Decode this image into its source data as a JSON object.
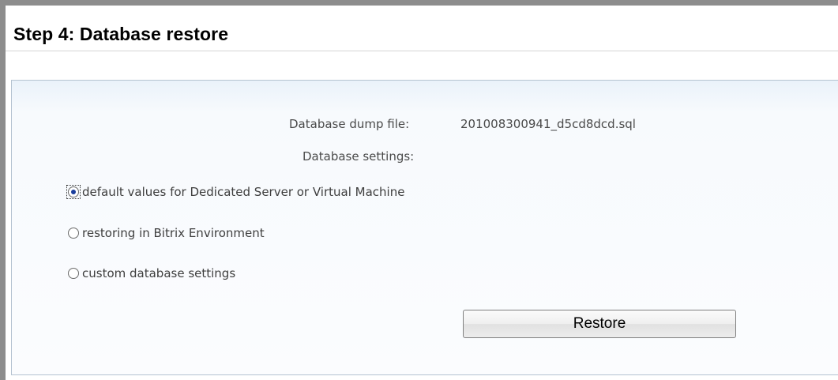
{
  "header": {
    "title": "Step 4: Database restore"
  },
  "form": {
    "dump_file_label": "Database dump file:",
    "dump_file_value": "201008300941_d5cd8dcd.sql",
    "db_settings_label": "Database settings:",
    "options": [
      {
        "label": "default values for Dedicated Server or Virtual Machine",
        "selected": true
      },
      {
        "label": "restoring in Bitrix Environment",
        "selected": false
      },
      {
        "label": "custom database settings",
        "selected": false
      }
    ],
    "restore_button": "Restore"
  }
}
